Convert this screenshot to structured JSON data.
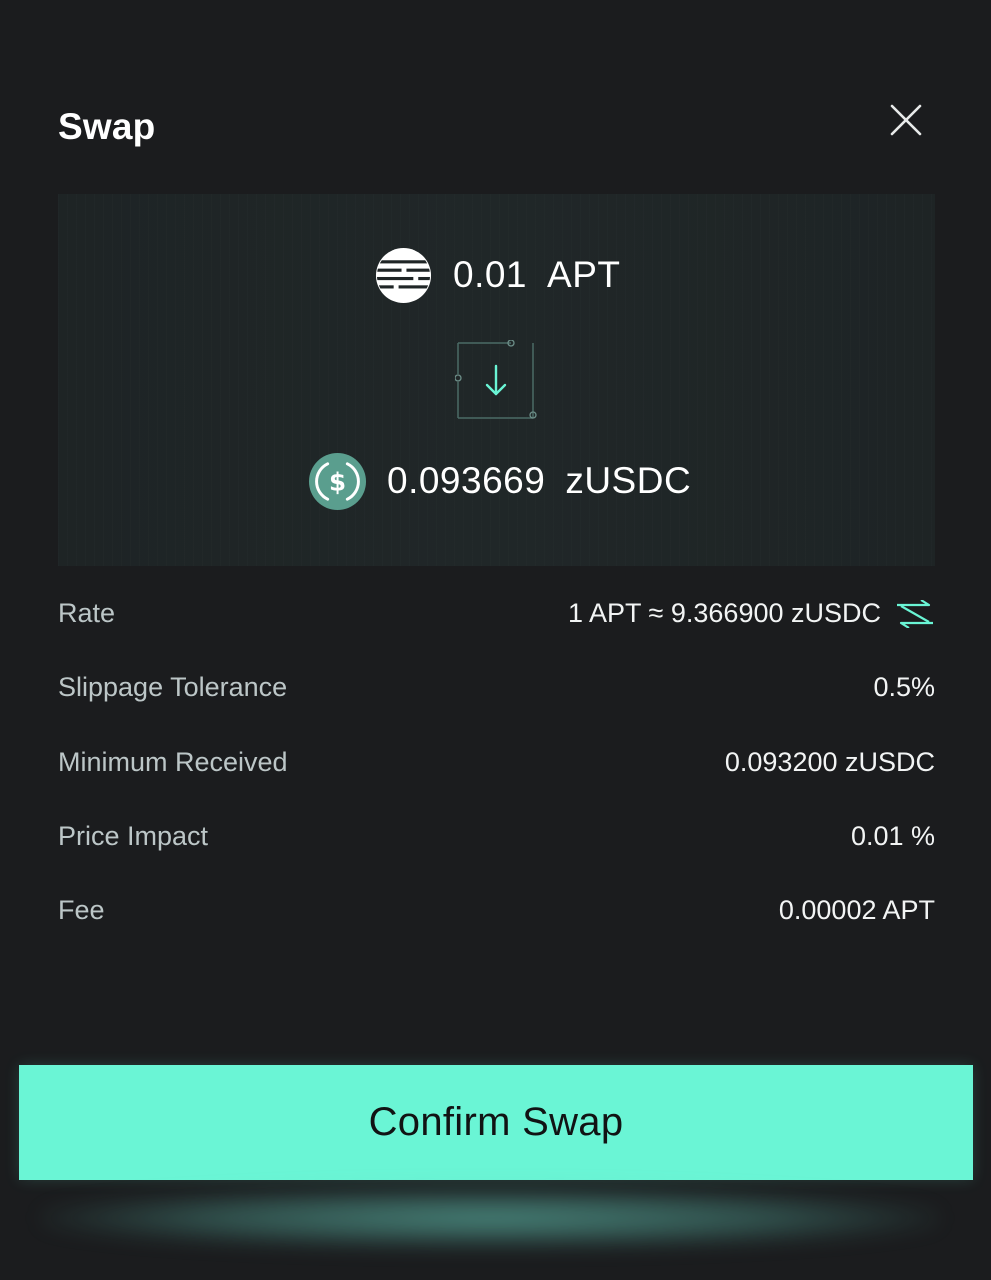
{
  "header": {
    "title": "Swap"
  },
  "swap": {
    "from": {
      "amount": "0.01",
      "symbol": "APT",
      "icon": "aptos-icon"
    },
    "to": {
      "amount": "0.093669",
      "symbol": "zUSDC",
      "icon": "usdc-icon"
    },
    "direction_icon": "arrow-down-icon"
  },
  "details": {
    "rate": {
      "label": "Rate",
      "value": "1 APT ≈ 9.366900 zUSDC"
    },
    "slippage": {
      "label": "Slippage Tolerance",
      "value": "0.5%"
    },
    "minimum_received": {
      "label": "Minimum Received",
      "value": "0.093200 zUSDC"
    },
    "price_impact": {
      "label": "Price Impact",
      "value": "0.01 %"
    },
    "fee": {
      "label": "Fee",
      "value": "0.00002 APT"
    }
  },
  "actions": {
    "confirm_label": "Confirm Swap"
  },
  "colors": {
    "background": "#1b1c1e",
    "accent": "#6af5d5",
    "usdc_icon": "#5a9e8e",
    "text_primary": "#ffffff",
    "text_secondary": "#bcc6c7"
  }
}
